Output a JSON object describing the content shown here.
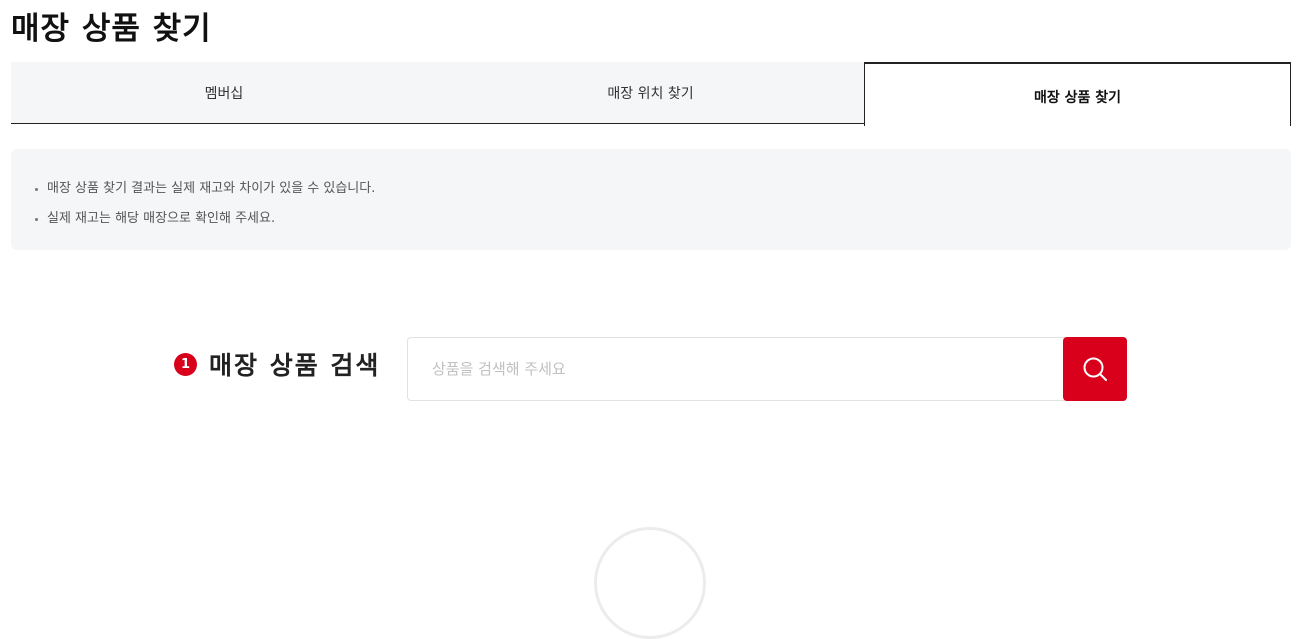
{
  "page": {
    "title": "매장 상품 찾기"
  },
  "tabs": [
    {
      "label": "멤버십"
    },
    {
      "label": "매장 위치 찾기"
    },
    {
      "label": "매장 상품 찾기",
      "active": true
    }
  ],
  "notice": {
    "items": [
      "매장 상품 찾기 결과는 실제 재고와 차이가 있을 수 있습니다.",
      "실제 재고는 해당 매장으로 확인해 주세요."
    ]
  },
  "search": {
    "step_number": "1",
    "label": "매장 상품 검색",
    "placeholder": "상품을 검색해 주세요",
    "value": "",
    "button_icon": "search-icon"
  },
  "colors": {
    "accent": "#d9001b",
    "panel_bg": "#f5f6f8"
  }
}
